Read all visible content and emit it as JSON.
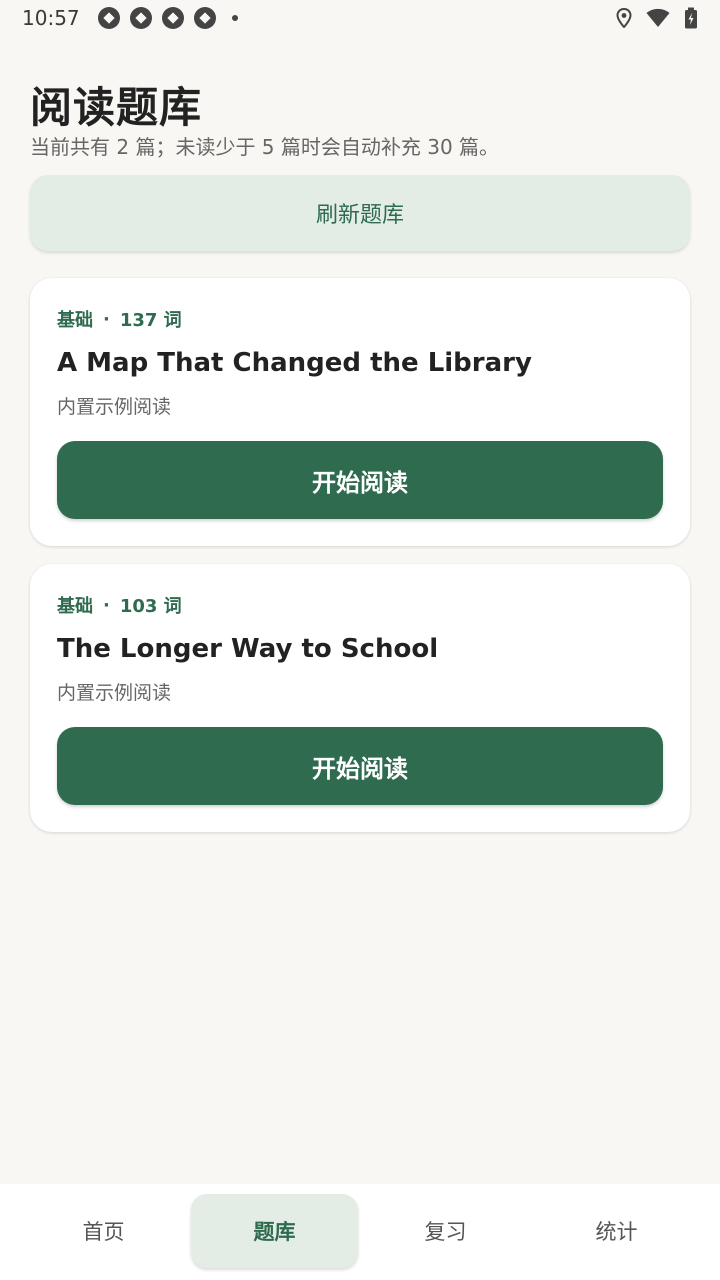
{
  "status_bar": {
    "time": "10:57",
    "icons": [
      "app-notification-icon",
      "app-notification-icon",
      "app-notification-icon",
      "app-notification-icon",
      "more-dot",
      "location-icon",
      "wifi-icon",
      "battery-icon"
    ]
  },
  "header": {
    "title": "阅读题库",
    "subtitle": "当前共有 2 篇；未读少于 5 篇时会自动补充 30 篇。"
  },
  "refresh_button": {
    "label": "刷新题库"
  },
  "articles": [
    {
      "level": "基础",
      "separator": "·",
      "word_count": "137 词",
      "title": "A Map That Changed the Library",
      "source": "内置示例阅读",
      "action_label": "开始阅读"
    },
    {
      "level": "基础",
      "separator": "·",
      "word_count": "103 词",
      "title": "The Longer Way to School",
      "source": "内置示例阅读",
      "action_label": "开始阅读"
    }
  ],
  "bottom_nav": {
    "items": [
      {
        "label": "首页",
        "active": false
      },
      {
        "label": "题库",
        "active": true
      },
      {
        "label": "复习",
        "active": false
      },
      {
        "label": "统计",
        "active": false
      }
    ]
  },
  "colors": {
    "accent": "#2f6b4f",
    "accent_light": "#e3ece5",
    "background": "#f8f7f3"
  }
}
